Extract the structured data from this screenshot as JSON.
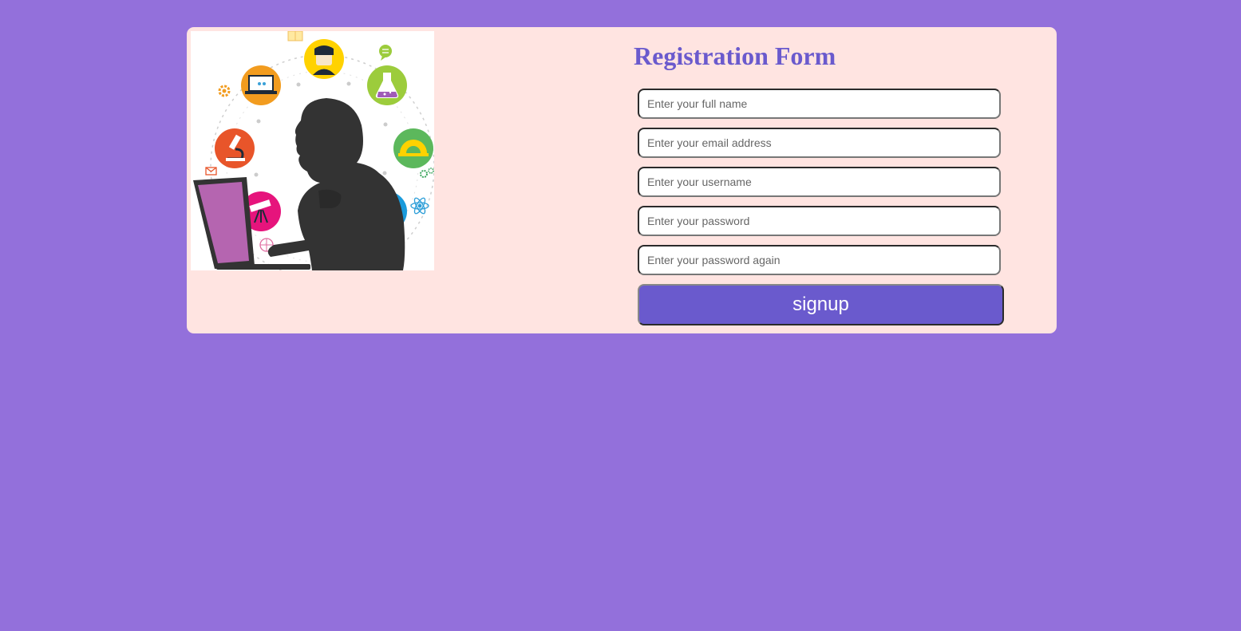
{
  "page": {
    "background_color": "#9370DB",
    "card_color": "#FFE4E1",
    "accent_color": "#6A5ACD"
  },
  "form": {
    "title": "Registration Form",
    "fields": [
      {
        "name": "full-name",
        "type": "text",
        "placeholder": "Enter your full name",
        "value": ""
      },
      {
        "name": "email",
        "type": "email",
        "placeholder": "Enter your email address",
        "value": ""
      },
      {
        "name": "username",
        "type": "text",
        "placeholder": "Enter your username",
        "value": ""
      },
      {
        "name": "password",
        "type": "password",
        "placeholder": "Enter your password",
        "value": ""
      },
      {
        "name": "password-again",
        "type": "password",
        "placeholder": "Enter your password again",
        "value": ""
      }
    ],
    "submit_label": "signup"
  },
  "illustration": {
    "subject": "person-silhouette-with-laptop",
    "icons": [
      "user-icon",
      "laptop-icon",
      "flask-icon",
      "microscope-icon",
      "protractor-icon",
      "telescope-icon",
      "globe-icon",
      "gear-icon",
      "chat-icon",
      "mail-icon",
      "atom-icon",
      "book-icon",
      "basketball-icon"
    ]
  }
}
